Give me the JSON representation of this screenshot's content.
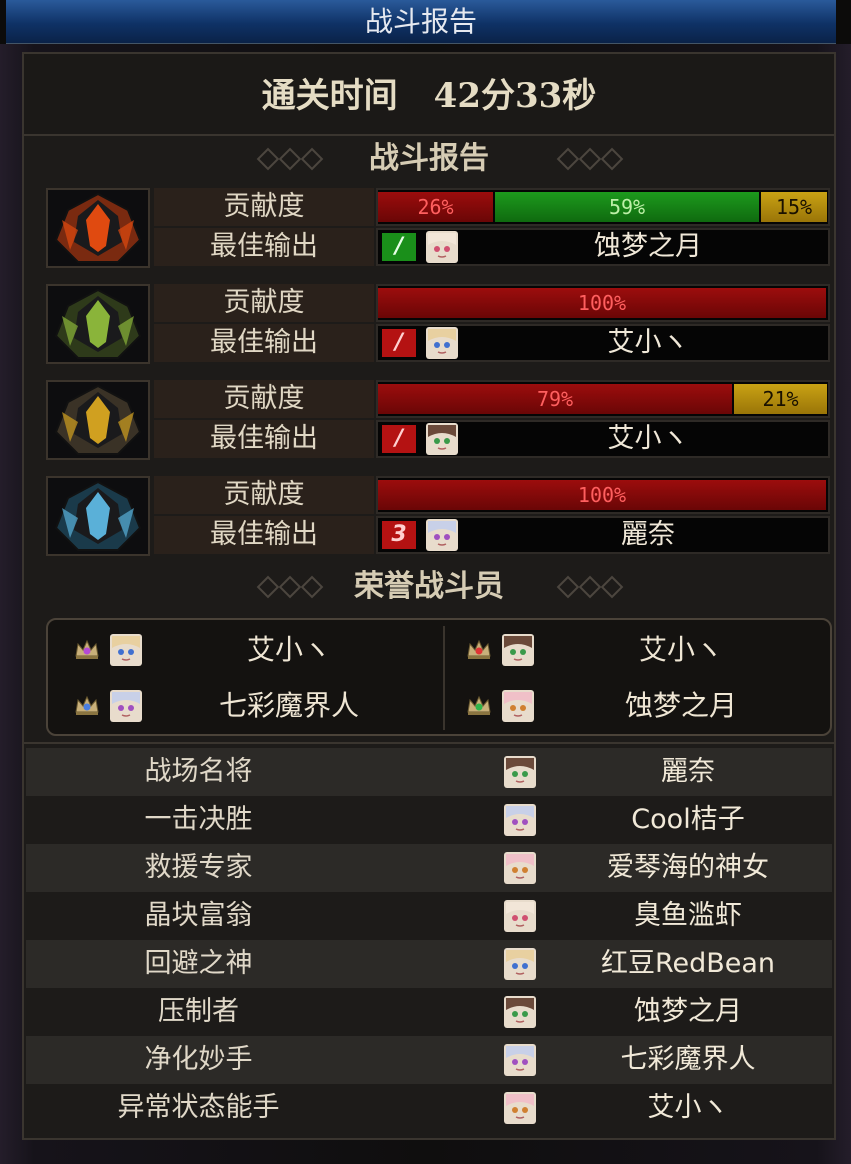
{
  "window": {
    "title": "战斗报告"
  },
  "clear_time": {
    "label": "通关时间",
    "value": "42分33秒"
  },
  "sections": {
    "report": "战斗报告",
    "honor": "荣誉战斗员"
  },
  "bosses": [
    {
      "icon": "fire-armor-boss-icon",
      "contrib_label": "贡献度",
      "best_label": "最佳输出",
      "segments": [
        {
          "pct": 26,
          "label": "26%",
          "color": "red"
        },
        {
          "pct": 59,
          "label": "59%",
          "color": "green"
        },
        {
          "pct": 15,
          "label": "15%",
          "color": "yellow"
        }
      ],
      "best_badge": "/",
      "best_badge_color": "green",
      "best_player": "蚀梦之月"
    },
    {
      "icon": "green-armor-boss-icon",
      "contrib_label": "贡献度",
      "best_label": "最佳输出",
      "segments": [
        {
          "pct": 100,
          "label": "100%",
          "color": "red"
        }
      ],
      "best_badge": "/",
      "best_badge_color": "red",
      "best_player": "艾小ヽ"
    },
    {
      "icon": "gold-armor-boss-icon",
      "contrib_label": "贡献度",
      "best_label": "最佳输出",
      "segments": [
        {
          "pct": 79,
          "label": "79%",
          "color": "red"
        },
        {
          "pct": 21,
          "label": "21%",
          "color": "yellow"
        }
      ],
      "best_badge": "/",
      "best_badge_color": "red",
      "best_player": "艾小ヽ"
    },
    {
      "icon": "ice-armor-boss-icon",
      "contrib_label": "贡献度",
      "best_label": "最佳输出",
      "segments": [
        {
          "pct": 100,
          "label": "100%",
          "color": "red"
        }
      ],
      "best_badge": "3",
      "best_badge_color": "red",
      "best_player": "麗奈"
    }
  ],
  "honor": [
    {
      "name": "艾小ヽ",
      "crown": "purple-gem-crown-icon",
      "gem_color": "#b54ad6"
    },
    {
      "name": "艾小ヽ",
      "crown": "red-gem-crown-icon",
      "gem_color": "#e03434"
    },
    {
      "name": "七彩魔界人",
      "crown": "blue-gem-crown-icon",
      "gem_color": "#4a7ee0"
    },
    {
      "name": "蚀梦之月",
      "crown": "green-gem-crown-icon",
      "gem_color": "#2fb44a"
    }
  ],
  "awards": [
    {
      "title": "战场名将",
      "player": "麗奈"
    },
    {
      "title": "一击决胜",
      "player": "Cool桔子"
    },
    {
      "title": "救援专家",
      "player": "爱琴海的神女"
    },
    {
      "title": "晶块富翁",
      "player": "臭鱼滥虾"
    },
    {
      "title": "回避之神",
      "player": "红豆RedBean"
    },
    {
      "title": "压制者",
      "player": "蚀梦之月"
    },
    {
      "title": "净化妙手",
      "player": "七彩魔界人"
    },
    {
      "title": "异常状态能手",
      "player": "艾小ヽ"
    }
  ]
}
